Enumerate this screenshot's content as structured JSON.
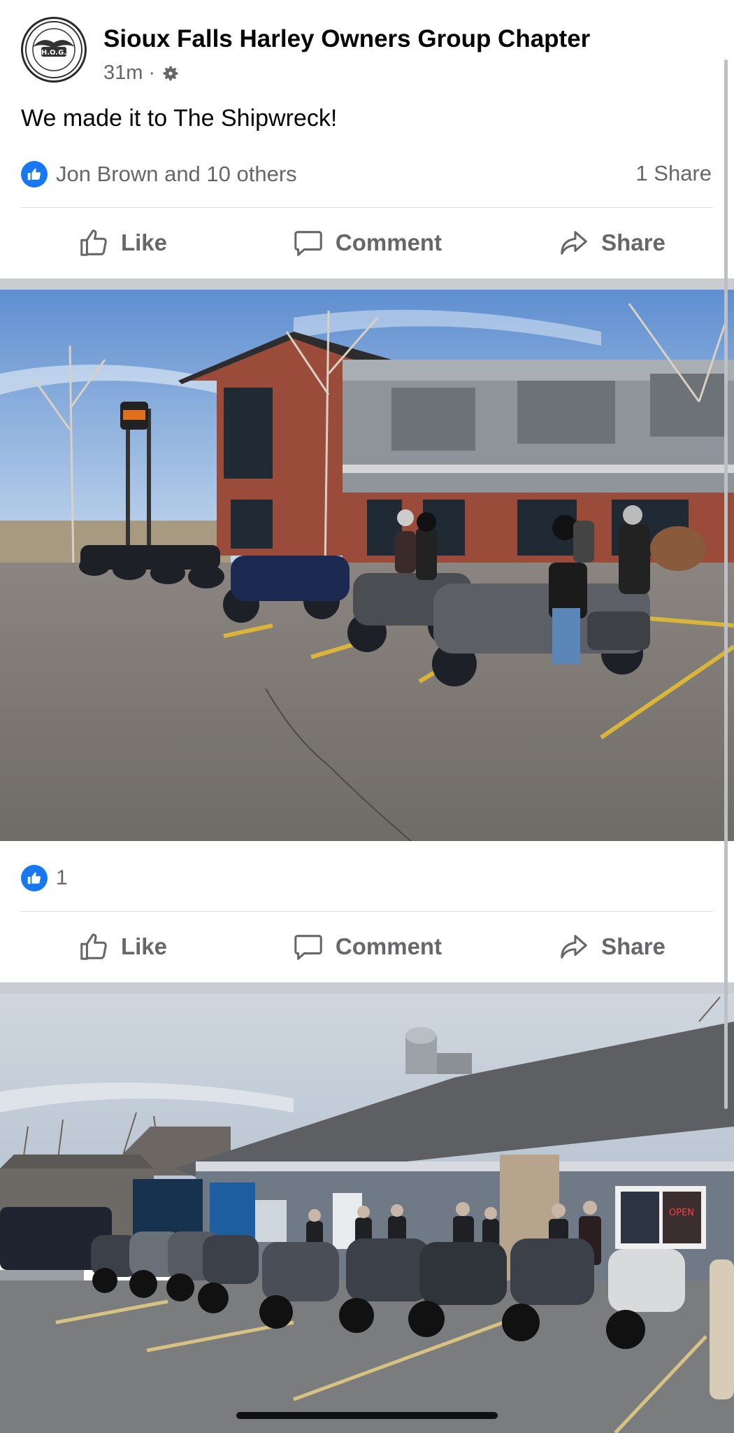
{
  "post": {
    "page_name": "Sioux Falls Harley Owners Group Chapter",
    "time": "31m",
    "separator": "·",
    "audience_icon": "gear-icon",
    "text": "We made it to The Shipwreck!",
    "reactions_text": "Jon Brown and 10 others",
    "shares_text": "1 Share",
    "avatar_logo_text": "H.O.G."
  },
  "actions": {
    "like": "Like",
    "comment": "Comment",
    "share": "Share"
  },
  "photo1": {
    "reaction_count": "1"
  },
  "colors": {
    "accent": "#1877f2",
    "secondary_text": "#65676b",
    "separator": "#c9ccd1"
  }
}
